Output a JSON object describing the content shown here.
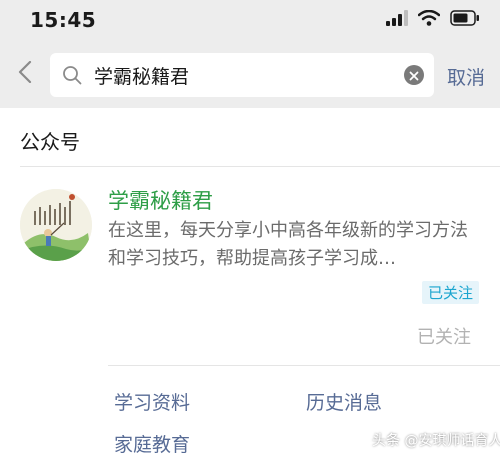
{
  "status_bar": {
    "time": "15:45"
  },
  "search": {
    "query": "学霸秘籍君",
    "cancel_label": "取消"
  },
  "section": {
    "header": "公众号"
  },
  "result": {
    "name": "学霸秘籍君",
    "description": "在这里，每天分享小中高各年级新的学习方法和学习技巧，帮助提高孩子学习成…",
    "tag": "已关注",
    "followed_label": "已关注"
  },
  "menu": {
    "items": [
      "学习资料",
      "历史消息",
      "家庭教育"
    ]
  },
  "watermark": "头条 @安琪师话育人",
  "colors": {
    "header_bg": "#ededed",
    "accent_green": "#2e9e47",
    "link_blue": "#576b95",
    "tag_text": "#1aa5cf",
    "tag_bg": "#e6f4fa"
  },
  "icons": [
    "signal-icon",
    "wifi-icon",
    "battery-icon",
    "back-chevron-icon",
    "search-icon",
    "clear-icon"
  ]
}
